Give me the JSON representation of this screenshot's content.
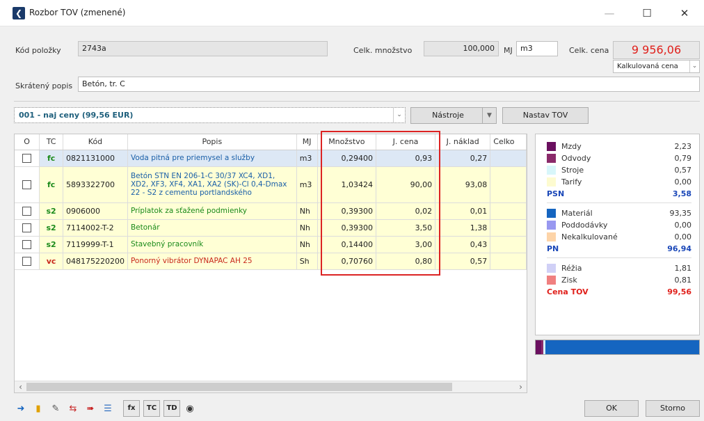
{
  "window": {
    "title": "Rozbor TOV (zmenené)"
  },
  "header": {
    "code_label": "Kód položky",
    "code_value": "2743a",
    "qty_label": "Celk. množstvo",
    "qty_value": "100,000",
    "unit_label": "MJ",
    "unit_value": "m3",
    "price_label": "Celk. cena",
    "price_value": "9 956,06",
    "price_mode": "Kalkulovaná cena",
    "short_desc_label": "Skrátený popis",
    "short_desc_value": "Betón, tr. C"
  },
  "toolbar": {
    "variant": "001 - naj ceny (99,56 EUR)",
    "tools_label": "Nástroje",
    "setup_label": "Nastav TOV"
  },
  "table": {
    "columns": [
      "O",
      "TC",
      "Kód",
      "Popis",
      "MJ",
      "Množstvo",
      "J. cena",
      "J. náklad",
      "Celko"
    ],
    "rows": [
      {
        "tc": "fc",
        "tc_color": "#1a8a1a",
        "code": "0821131000",
        "desc": "Voda pitná pre priemysel a služby",
        "desc_color": "#1a5fa8",
        "mj": "m3",
        "qty": "0,29400",
        "unit_price": "0,93",
        "unit_cost": "0,27"
      },
      {
        "tc": "fc",
        "tc_color": "#1a8a1a",
        "code": "5893322700",
        "desc": "Betón STN EN 206-1-C 30/37 XC4, XD1, XD2, XF3, XF4, XA1, XA2 (SK)-Cl 0,4-Dmax 22 - S2 z cementu portlandského",
        "desc_color": "#1a5fa8",
        "mj": "m3",
        "qty": "1,03424",
        "unit_price": "90,00",
        "unit_cost": "93,08"
      },
      {
        "tc": "s2",
        "tc_color": "#1a8a1a",
        "code": "0906000",
        "desc": "Príplatok za sťažené podmienky",
        "desc_color": "#1a8a1a",
        "mj": "Nh",
        "qty": "0,39300",
        "unit_price": "0,02",
        "unit_cost": "0,01"
      },
      {
        "tc": "s2",
        "tc_color": "#1a8a1a",
        "code": "7114002-T-2",
        "desc": "Betonár",
        "desc_color": "#1a8a1a",
        "mj": "Nh",
        "qty": "0,39300",
        "unit_price": "3,50",
        "unit_cost": "1,38"
      },
      {
        "tc": "s2",
        "tc_color": "#1a8a1a",
        "code": "7119999-T-1",
        "desc": "Stavebný pracovník",
        "desc_color": "#1a8a1a",
        "mj": "Nh",
        "qty": "0,14400",
        "unit_price": "3,00",
        "unit_cost": "0,43"
      },
      {
        "tc": "vc",
        "tc_color": "#c8281b",
        "code": "048175220200",
        "desc": "Ponorný vibrátor DYNAPAC AH 25",
        "desc_color": "#c8281b",
        "mj": "Sh",
        "qty": "0,70760",
        "unit_price": "0,80",
        "unit_cost": "0,57"
      }
    ]
  },
  "summary": {
    "items": [
      {
        "name": "Mzdy",
        "value": "2,23",
        "color": "#6a0f5f"
      },
      {
        "name": "Odvody",
        "value": "0,79",
        "color": "#8a2a6a"
      },
      {
        "name": "Stroje",
        "value": "0,57",
        "color": "#d8f6fa"
      },
      {
        "name": "Tarify",
        "value": "0,00",
        "color": "#fdfbd0"
      },
      {
        "name": "PSN",
        "value": "3,58",
        "kind": "total"
      },
      {
        "name": "Materiál",
        "value": "93,35",
        "color": "#1565c0"
      },
      {
        "name": "Poddodávky",
        "value": "0,00",
        "color": "#9898f0"
      },
      {
        "name": "Nekalkulované",
        "value": "0,00",
        "color": "#fdd4a8"
      },
      {
        "name": "PN",
        "value": "96,94",
        "kind": "total"
      },
      {
        "name": "Réžia",
        "value": "1,81",
        "color": "#d0d0f6"
      },
      {
        "name": "Zisk",
        "value": "0,81",
        "color": "#f08080"
      },
      {
        "name": "Cena TOV",
        "value": "99,56",
        "kind": "grand"
      }
    ]
  },
  "bottom": {
    "fx_label": "fx",
    "tc_label": "TC",
    "td_label": "TD",
    "ok_label": "OK",
    "cancel_label": "Storno"
  }
}
